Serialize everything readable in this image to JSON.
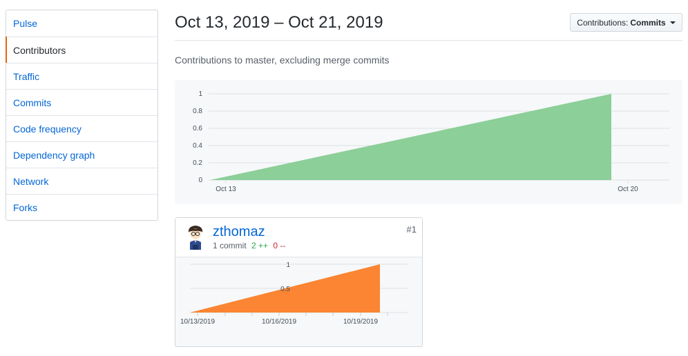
{
  "sidebar": {
    "items": [
      {
        "label": "Pulse",
        "selected": false
      },
      {
        "label": "Contributors",
        "selected": true
      },
      {
        "label": "Traffic",
        "selected": false
      },
      {
        "label": "Commits",
        "selected": false
      },
      {
        "label": "Code frequency",
        "selected": false
      },
      {
        "label": "Dependency graph",
        "selected": false
      },
      {
        "label": "Network",
        "selected": false
      },
      {
        "label": "Forks",
        "selected": false
      }
    ]
  },
  "header": {
    "date_range": "Oct 13, 2019 – Oct 21, 2019",
    "dropdown_label": "Contributions:",
    "dropdown_value": "Commits"
  },
  "subtitle": "Contributions to master, excluding merge commits",
  "colors": {
    "main_area": "#8ccf98",
    "user_area": "#fb8532",
    "selected_accent": "#e36209",
    "link": "#0366d6"
  },
  "contributor": {
    "username": "zthomaz",
    "commits": "1 commit",
    "additions": "2 ++",
    "deletions": "0 --",
    "rank": "#1",
    "avatar_icon": "cartoon-avatar-icon"
  },
  "chart_data": [
    {
      "type": "area",
      "x": [
        "Oct 13",
        "Oct 20"
      ],
      "x_ticks": [
        "Oct 13",
        "Oct 20"
      ],
      "series": [
        {
          "values": [
            0,
            1
          ]
        }
      ],
      "y_ticks": [
        "0",
        "0.2",
        "0.4",
        "0.6",
        "0.8",
        "1"
      ],
      "ylim": [
        0,
        1
      ],
      "grid": true
    },
    {
      "type": "area",
      "x": [
        "10/13/2019",
        "10/20/2019"
      ],
      "x_ticks": [
        "10/13/2019",
        "10/16/2019",
        "10/19/2019"
      ],
      "series": [
        {
          "values": [
            0,
            1
          ]
        }
      ],
      "y_ticks": [
        "1",
        "0.5"
      ],
      "ylim": [
        0,
        1
      ],
      "grid": true
    }
  ]
}
